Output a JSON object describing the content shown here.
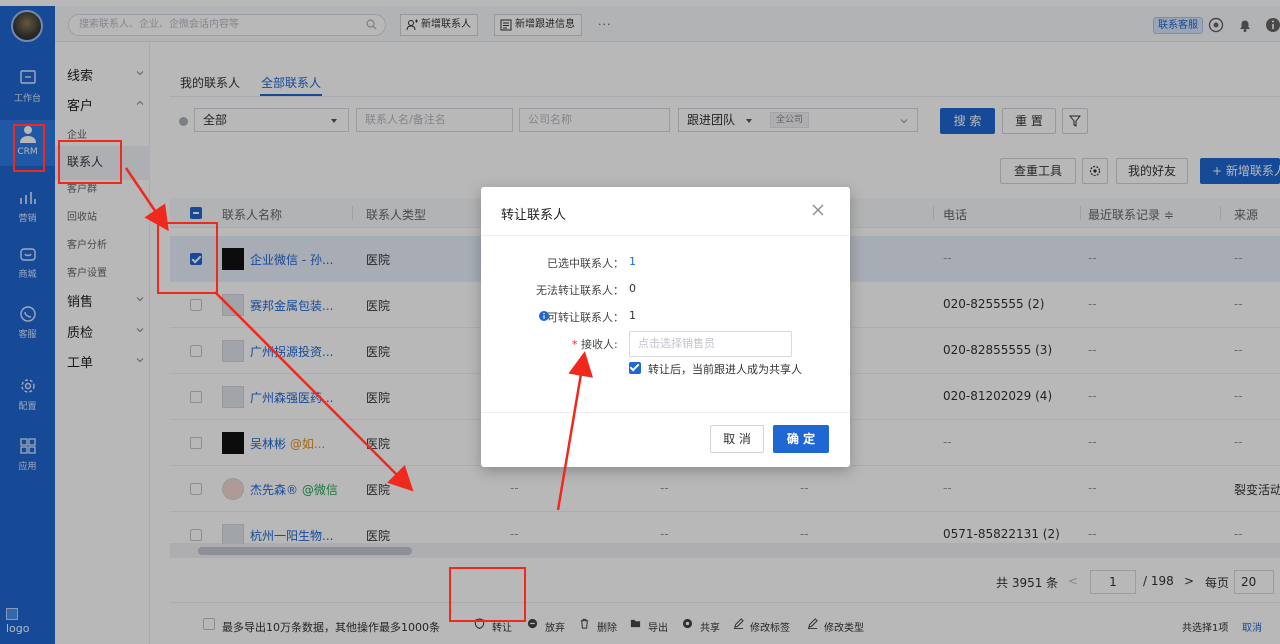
{
  "topbar": {
    "search_placeholder": "搜索联系人、企业、企微会话内容等",
    "new_contact": "新增联系人",
    "new_followup": "新增跟进信息",
    "more": "···",
    "support_badge": "联系客服"
  },
  "rail": [
    {
      "label": "工作台",
      "icon": "workbench-icon"
    },
    {
      "label": "CRM",
      "icon": "user-icon"
    },
    {
      "label": "营销",
      "icon": "marketing-icon"
    },
    {
      "label": "商城",
      "icon": "shop-icon"
    },
    {
      "label": "客服",
      "icon": "chat-icon"
    },
    {
      "label": "配置",
      "icon": "settings-icon"
    },
    {
      "label": "应用",
      "icon": "apps-icon"
    }
  ],
  "rail_logo": "logo",
  "subnav": {
    "leads": "线索",
    "customer": "客户",
    "company": "企业",
    "contacts": "联系人",
    "customer_group": "客户群",
    "recycle": "回收站",
    "analysis": "客户分析",
    "cust_settings": "客户设置",
    "sales": "销售",
    "quality": "质检",
    "ticket": "工单"
  },
  "tabs": {
    "my": "我的联系人",
    "all": "全部联系人"
  },
  "filters": {
    "scope": "全部",
    "name_placeholder": "联系人名/备注名",
    "company_placeholder": "公司名称",
    "team": "跟进团队",
    "team_chip": "全公司",
    "search": "搜 索",
    "reset": "重 置"
  },
  "tools": {
    "dup_check": "查重工具",
    "friends": "我的好友",
    "new_contact": "+ 新增联系人"
  },
  "table": {
    "headers": {
      "name": "联系人名称",
      "type": "联系人类型",
      "phone": "电话",
      "recent": "最近联系记录 ≑",
      "source": "来源"
    },
    "rows": [
      {
        "name": "企业微信 - 孙...",
        "at": "",
        "type": "医院",
        "phone": "--",
        "recent": "--",
        "source": "--",
        "selected": true
      },
      {
        "name": "赛邦金属包装...",
        "at": "",
        "type": "医院",
        "phone": "020-8255555 (2)",
        "recent": "--",
        "source": "--",
        "selected": false
      },
      {
        "name": "广州拐源投资...",
        "at": "",
        "type": "医院",
        "phone": "020-82855555 (3)",
        "recent": "--",
        "source": "--",
        "selected": false
      },
      {
        "name": "广州森强医药...",
        "at": "",
        "type": "医院",
        "phone": "020-81202029 (4)",
        "recent": "--",
        "source": "--",
        "selected": false
      },
      {
        "name": "吴林彬 ",
        "at": "@如...",
        "type": "医院",
        "phone": "--",
        "recent": "--",
        "source": "--",
        "selected": false
      },
      {
        "name": "杰先森® ",
        "at": "@微信",
        "type": "医院",
        "phone": "--",
        "recent": "--",
        "source": "裂变活动",
        "selected": false
      },
      {
        "name": "杭州一阳生物...",
        "at": "",
        "type": "医院",
        "phone": "0571-85822131 (2)",
        "recent": "--",
        "source": "--",
        "selected": false
      }
    ],
    "dash": "--"
  },
  "pager": {
    "total": "共 3951 条",
    "prev": "<",
    "page": "1",
    "of": "/ 198",
    "next": ">",
    "per_label": "每页",
    "per": "20"
  },
  "bottom": {
    "export_note": "最多导出10万条数据，其他操作最多1000条",
    "transfer": "转让",
    "abandon": "放弃",
    "delete": "删除",
    "export": "导出",
    "share": "共享",
    "edit_tags": "修改标签",
    "edit_type": "修改类型",
    "selected": "共选择1项",
    "cancel": "取消"
  },
  "modal": {
    "title": "转让联系人",
    "selected_label": "已选中联系人：",
    "selected_val": "1",
    "cannot_label": "无法转让联系人：",
    "cannot_val": "0",
    "can_label": "可转让联系人：",
    "can_val": "1",
    "required": "*",
    "receiver_label": "接收人:",
    "receiver_placeholder": "点击选择销售员",
    "share_check": "转让后，当前跟进人成为共享人",
    "cancel": "取 消",
    "confirm": "确 定"
  },
  "colors": {
    "brand": "#1f67d2",
    "annotation": "#f0281e"
  }
}
